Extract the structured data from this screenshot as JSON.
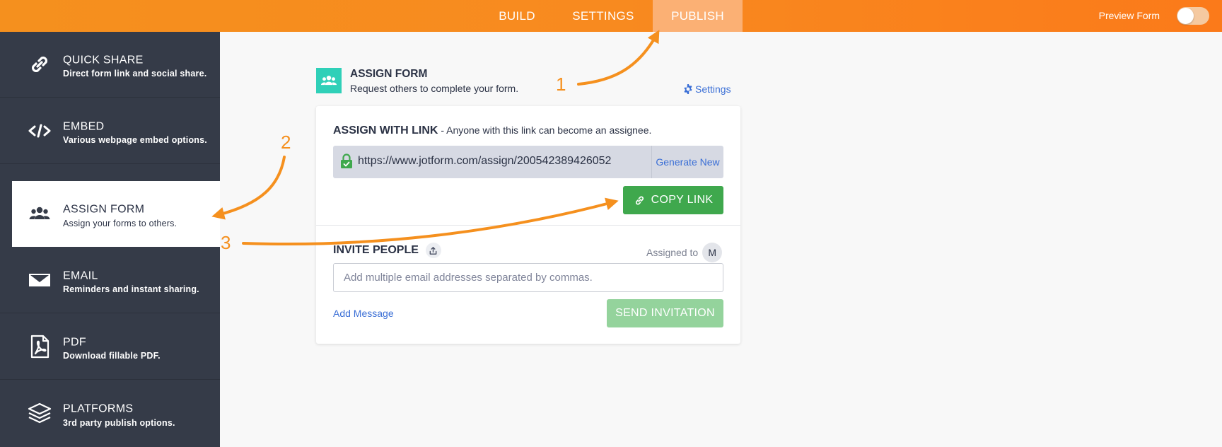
{
  "topbar": {
    "tabs": [
      {
        "label": "BUILD"
      },
      {
        "label": "SETTINGS"
      },
      {
        "label": "PUBLISH",
        "active": true
      }
    ],
    "preview_label": "Preview Form",
    "preview_enabled": false
  },
  "sidebar": {
    "items": [
      {
        "title": "QUICK SHARE",
        "desc": "Direct form link and social share.",
        "icon": "link-icon"
      },
      {
        "title": "EMBED",
        "desc": "Various webpage embed options.",
        "icon": "code-icon"
      },
      {
        "title": "ASSIGN FORM",
        "desc": "Assign your forms to others.",
        "icon": "users-icon",
        "active": true
      },
      {
        "title": "EMAIL",
        "desc": "Reminders and instant sharing.",
        "icon": "envelope-icon"
      },
      {
        "title": "PDF",
        "desc": "Download fillable PDF.",
        "icon": "pdf-icon"
      },
      {
        "title": "PLATFORMS",
        "desc": "3rd party publish options.",
        "icon": "layers-icon"
      }
    ]
  },
  "main": {
    "title": "ASSIGN FORM",
    "subtitle": "Request others to complete your form.",
    "settings_label": "Settings",
    "assign_with_link": {
      "heading": "ASSIGN WITH LINK",
      "separator": " - ",
      "description": "Anyone with this link can become an assignee.",
      "url": "https://www.jotform.com/assign/200542389426052",
      "generate_label": "Generate New",
      "copy_label": "COPY LINK"
    },
    "invite": {
      "heading": "INVITE PEOPLE",
      "assigned_label": "Assigned to",
      "avatar_initial": "M",
      "email_placeholder": "Add multiple email addresses separated by commas.",
      "add_message_label": "Add Message",
      "send_label": "SEND INVITATION"
    }
  },
  "annotations": {
    "step1": "1",
    "step2": "2",
    "step3": "3"
  },
  "colors": {
    "accent_orange": "#f5901e",
    "sidebar_bg": "#353b48",
    "copy_green": "#3fa84d",
    "send_green_disabled": "#94d39c",
    "link_blue": "#3b6fd6",
    "assign_teal": "#2fd0b8"
  }
}
